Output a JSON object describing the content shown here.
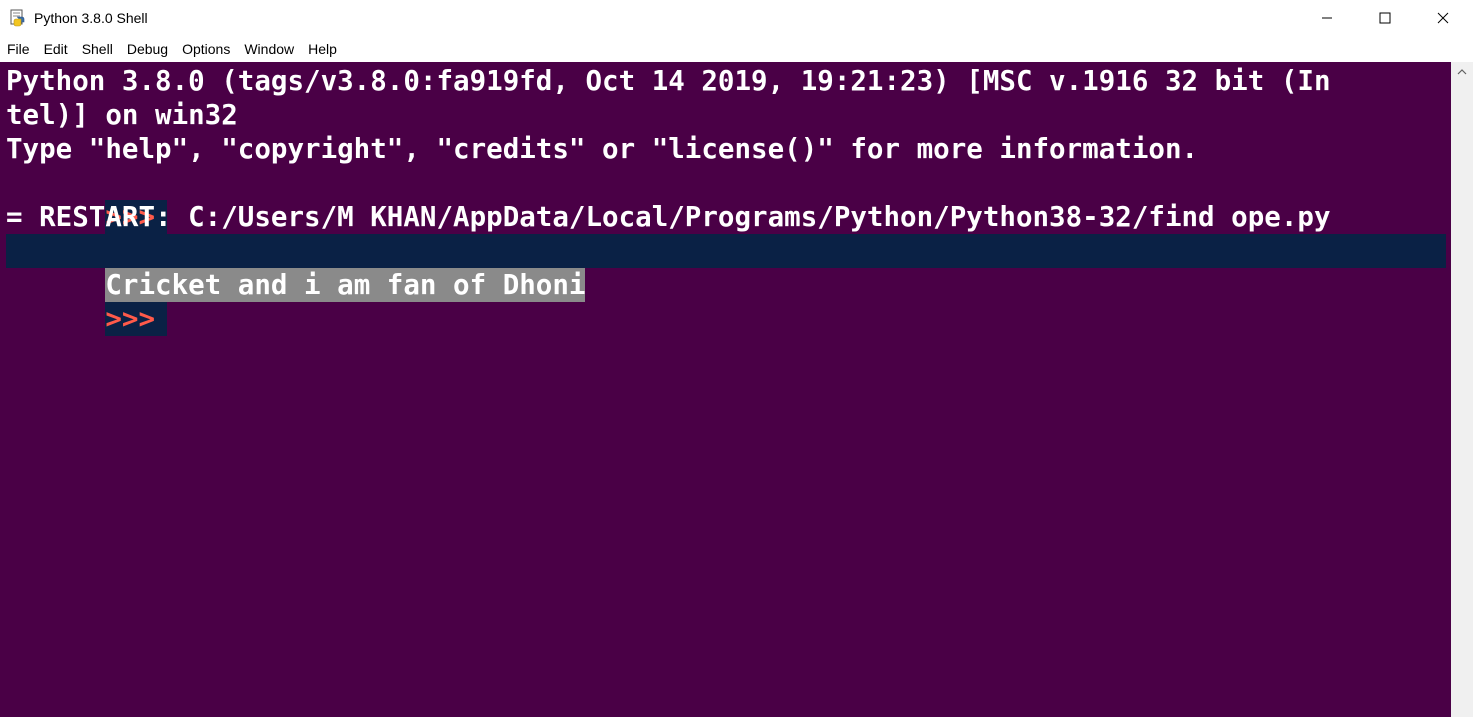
{
  "window": {
    "title": "Python 3.8.0 Shell",
    "icon": "python-idle-icon",
    "controls": {
      "minimize": "minimize-icon",
      "maximize": "maximize-icon",
      "close": "close-icon"
    }
  },
  "menubar": {
    "items": [
      {
        "label": "File"
      },
      {
        "label": "Edit"
      },
      {
        "label": "Shell"
      },
      {
        "label": "Debug"
      },
      {
        "label": "Options"
      },
      {
        "label": "Window"
      },
      {
        "label": "Help"
      }
    ]
  },
  "shell": {
    "background": "#4a0046",
    "prompt_color": "#ff5a4a",
    "lines": {
      "banner1": "Python 3.8.0 (tags/v3.8.0:fa919fd, Oct 14 2019, 19:21:23) [MSC v.1916 32 bit (In",
      "banner2": "tel)] on win32",
      "banner3": "Type \"help\", \"copyright\", \"credits\" or \"license()\" for more information.",
      "prompt1": ">>>",
      "restart": "= RESTART: C:/Users/M KHAN/AppData/Local/Programs/Python/Python38-32/find ope.py",
      "output": "Cricket and i am fan of Dhoni",
      "prompt2": ">>>"
    }
  }
}
